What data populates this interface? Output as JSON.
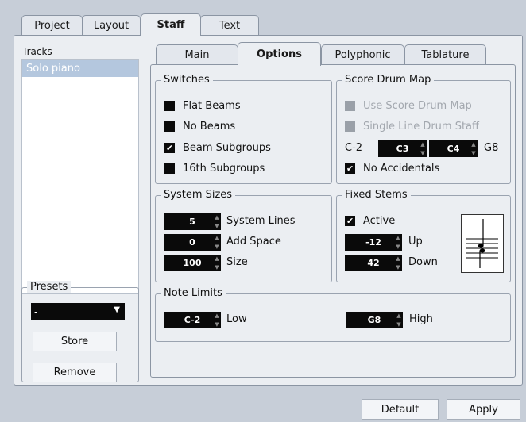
{
  "top_tabs": [
    "Project",
    "Layout",
    "Staff",
    "Text"
  ],
  "tracks": {
    "label": "Tracks",
    "items": [
      "Solo piano"
    ]
  },
  "presets": {
    "legend": "Presets",
    "selected": "-",
    "store_label": "Store",
    "remove_label": "Remove"
  },
  "sub_tabs": [
    "Main",
    "Options",
    "Polyphonic",
    "Tablature"
  ],
  "switches": {
    "legend": "Switches",
    "items": [
      {
        "label": "Flat Beams",
        "checked": false
      },
      {
        "label": "No Beams",
        "checked": false
      },
      {
        "label": "Beam Subgroups",
        "checked": true
      },
      {
        "label": "16th Subgroups",
        "checked": false
      }
    ]
  },
  "drum_map": {
    "legend": "Score Drum Map",
    "use_label": "Use Score Drum Map",
    "single_line_label": "Single Line Drum Staff",
    "range_from": "C-2",
    "spin_low": "C3",
    "spin_high": "C4",
    "range_to": "G8",
    "no_accidentals_label": "No Accidentals"
  },
  "system_sizes": {
    "legend": "System Sizes",
    "system_lines_value": "5",
    "system_lines_label": "System Lines",
    "add_space_value": "0",
    "add_space_label": "Add Space",
    "size_value": "100",
    "size_label": "Size"
  },
  "fixed_stems": {
    "legend": "Fixed Stems",
    "active_label": "Active",
    "up_value": "-12",
    "up_label": "Up",
    "down_value": "42",
    "down_label": "Down"
  },
  "note_limits": {
    "legend": "Note Limits",
    "low_value": "C-2",
    "low_label": "Low",
    "high_value": "G8",
    "high_label": "High"
  },
  "footer": {
    "default_label": "Default",
    "apply_label": "Apply"
  },
  "colors": {
    "background": "#c7ced8",
    "panel": "#ebeef2",
    "selection": "#b4c7de",
    "field": "#0a0a0a"
  }
}
